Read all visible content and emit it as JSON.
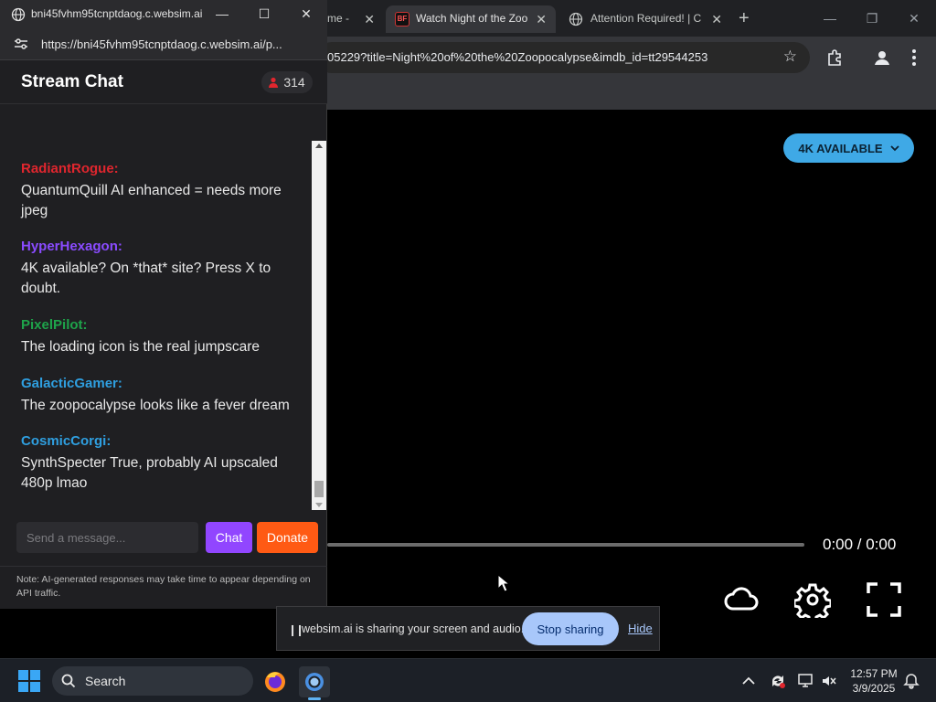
{
  "browser": {
    "tabs": [
      {
        "title": "me -",
        "state": "partial"
      },
      {
        "title": "Watch Night of the Zoo",
        "state": "active",
        "favicon_text": "BF"
      },
      {
        "title": "Attention Required! | C",
        "state": "inactive"
      }
    ],
    "address": "05229?title=Night%20of%20the%20Zoopocalypse&imdb_id=tt29544253"
  },
  "player": {
    "quality_label": "4K AVAILABLE",
    "time": "0:00 / 0:00",
    "progress_fraction": 0.0
  },
  "popup": {
    "window_title": "bni45fvhm95tcnptdaog.c.websim.ai",
    "url": "https://bni45fvhm95tcnptdaog.c.websim.ai/p...",
    "chat_title": "Stream Chat",
    "viewer_count": "314",
    "messages": [
      {
        "user": "RadiantRogue:",
        "text": "QuantumQuill AI enhanced = needs more jpeg",
        "color": "#e0262e"
      },
      {
        "user": "HyperHexagon:",
        "text": "4K available? On *that* site? Press X to doubt.",
        "color": "#8a4bff"
      },
      {
        "user": "PixelPilot:",
        "text": "The loading icon is the real jumpscare",
        "color": "#1ea34a"
      },
      {
        "user": "GalacticGamer:",
        "text": "The zoopocalypse looks like a fever dream",
        "color": "#2f9fe0"
      },
      {
        "user": "CosmicCorgi:",
        "text": "SynthSpecter True, probably AI upscaled 480p lmao",
        "color": "#2f9fe0"
      }
    ],
    "input_placeholder": "Send a message...",
    "chat_button": "Chat",
    "donate_button": "Donate",
    "note": "Note: AI-generated responses may take time to appear depending on API traffic."
  },
  "sharing": {
    "message": "websim.ai is sharing your screen and audio.",
    "stop_label": "Stop sharing",
    "hide_label": "Hide"
  },
  "taskbar": {
    "search_label": "Search",
    "time": "12:57 PM",
    "date": "3/9/2025"
  }
}
